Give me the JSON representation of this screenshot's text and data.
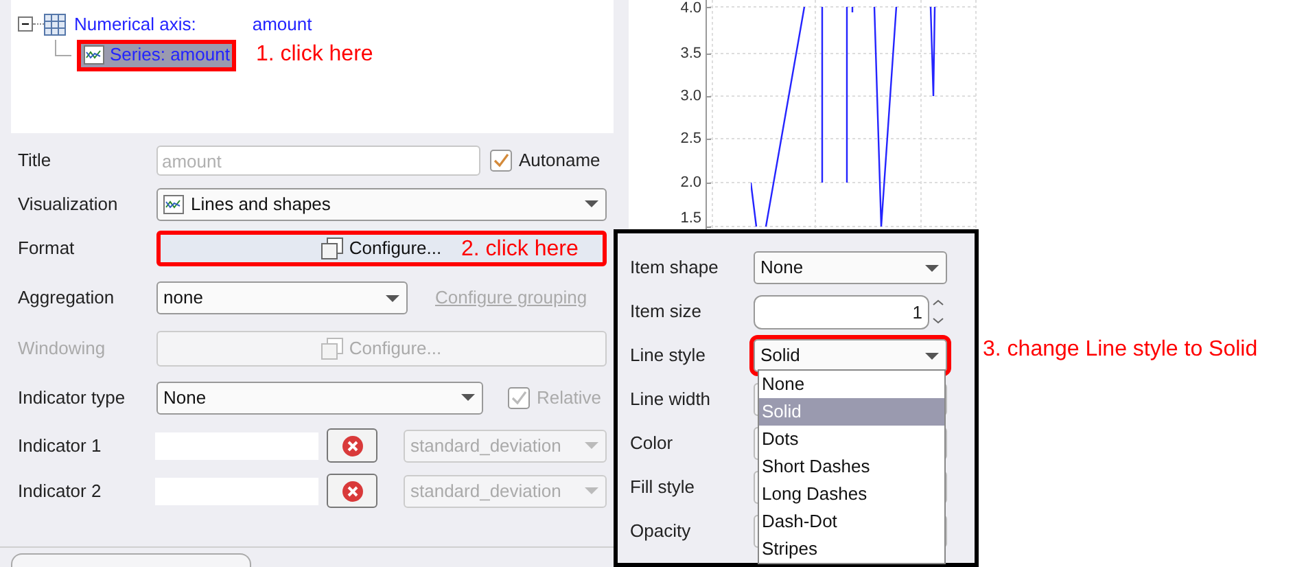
{
  "tree": {
    "items": [
      {
        "label": "Numerical axis:",
        "value": "amount",
        "expanded": true,
        "children": [
          {
            "label": "Series: amount",
            "selected": true,
            "highlighted": true
          }
        ]
      }
    ]
  },
  "form": {
    "title": {
      "label": "Title",
      "placeholder": "amount",
      "autoname": {
        "label": "Autoname",
        "checked": true
      }
    },
    "visualization": {
      "label": "Visualization",
      "value": "Lines and shapes"
    },
    "format": {
      "label": "Format",
      "button": "Configure...",
      "highlighted": true
    },
    "aggregation": {
      "label": "Aggregation",
      "value": "none",
      "link": "Configure grouping"
    },
    "windowing": {
      "label": "Windowing",
      "button": "Configure...",
      "disabled": true
    },
    "indicator_type": {
      "label": "Indicator type",
      "value": "None",
      "relative": {
        "label": "Relative",
        "checked": true,
        "disabled": true
      }
    },
    "indicators": [
      {
        "label": "Indicator 1",
        "function": "standard_deviation"
      },
      {
        "label": "Indicator 2",
        "function": "standard_deviation"
      }
    ]
  },
  "chart": {
    "y_tick_labels": [
      "4.0",
      "3.5",
      "3.0",
      "2.5",
      "2.0",
      "1.5"
    ]
  },
  "format_popup": {
    "rows": [
      {
        "kind": "select",
        "label": "Item shape",
        "value": "None",
        "highlighted": false
      },
      {
        "kind": "spinner",
        "label": "Item size",
        "value": "1"
      },
      {
        "kind": "select",
        "label": "Line style",
        "value": "Solid",
        "highlighted": true
      },
      {
        "kind": "covered",
        "label": "Line width"
      },
      {
        "kind": "covered",
        "label": "Color"
      },
      {
        "kind": "covered",
        "label": "Fill style"
      },
      {
        "kind": "covered",
        "label": "Opacity"
      }
    ],
    "dropdown": {
      "options": [
        {
          "label": "None",
          "selected": false
        },
        {
          "label": "Solid",
          "selected": true
        },
        {
          "label": "Dots",
          "selected": false
        },
        {
          "label": "Short Dashes",
          "selected": false
        },
        {
          "label": "Long Dashes",
          "selected": false
        },
        {
          "label": "Dash-Dot",
          "selected": false
        },
        {
          "label": "Stripes",
          "selected": false
        }
      ]
    }
  },
  "annotations": [
    {
      "text": "1. click here"
    },
    {
      "text": "2. click here"
    },
    {
      "text": "3. change Line style to Solid"
    }
  ]
}
